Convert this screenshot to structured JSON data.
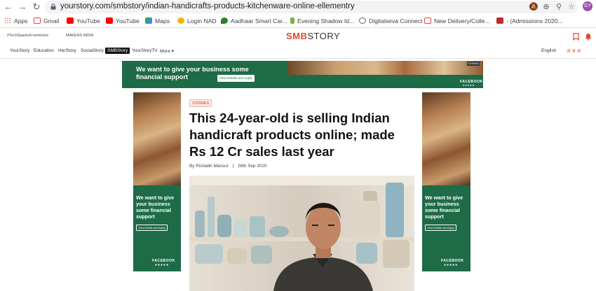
{
  "browser": {
    "url": "yourstory.com/smbstory/indian-handicrafts-products-kitchenware-online-ellementry",
    "profile_initials": "GY",
    "bookmarks": [
      {
        "label": "Apps",
        "icon": "apps-grid-icon",
        "color": "#4285f4"
      },
      {
        "label": "Gmail",
        "icon": "gmail-icon",
        "color": "#ea4335"
      },
      {
        "label": "YouTube",
        "icon": "youtube-icon",
        "color": "#ff0000"
      },
      {
        "label": "YouTube",
        "icon": "youtube-icon",
        "color": "#ff0000"
      },
      {
        "label": "Maps",
        "icon": "maps-icon",
        "color": "#34a853"
      },
      {
        "label": "Login NAD",
        "icon": "nad-icon",
        "color": "#f4b400"
      },
      {
        "label": "Aadhaar Smart Car...",
        "icon": "aadhaar-icon",
        "color": "#2e7d32"
      },
      {
        "label": "Evening Shadow Id...",
        "icon": "shadow-icon",
        "color": "#7cb342"
      },
      {
        "label": "Digitalseva Connect",
        "icon": "globe-icon",
        "color": "#5f6368"
      },
      {
        "label": "New Delivery/Colle...",
        "icon": "gmail-icon",
        "color": "#ea4335"
      },
      {
        "label": "- (Admissions 2020...",
        "icon": "admissions-icon",
        "color": "#c62828"
      }
    ]
  },
  "site": {
    "top_links": [
      "#TechSparksFromHome",
      "MAKERS INDIA"
    ],
    "logo_smb": "SMB",
    "logo_story": "STORY",
    "nav": [
      "YourStory",
      "Education",
      "HerStory",
      "SocialStory",
      "SMBStory",
      "YourStoryTV",
      "More ▾"
    ],
    "active_nav": "SMBStory",
    "language": "English",
    "language_chars": "अं अ अ"
  },
  "ads": {
    "banner_text": "We want to give your business some financial support",
    "banner_button": "View Details and Apply",
    "banner_expand": "EXPAND",
    "banner_brand": "FACEBOOK",
    "side_text": "We want to give your business some financial support",
    "side_button": "View Details and Apply",
    "side_brand": "FACEBOOK",
    "social_dots": "●●●●●"
  },
  "article": {
    "category": "STORIES",
    "headline": "This 24-year-old is selling Indian handicraft products online; made Rs 12 Cr sales last year",
    "author": "By Rishabh Mansur",
    "separator": "|",
    "date": "26th Sep 2020"
  },
  "colors": {
    "brand_red": "#e0492a",
    "ad_green": "#1e6b47",
    "badge_red": "#c0392b"
  }
}
